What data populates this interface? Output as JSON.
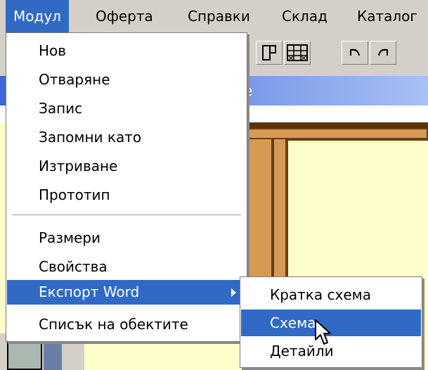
{
  "menubar": {
    "items": [
      "Модул",
      "Оферта",
      "Справки",
      "Склад",
      "Каталог"
    ],
    "active_index": 0
  },
  "window": {
    "title_fragment": "е"
  },
  "dropdown": {
    "items": [
      "Нов",
      "Отваряне",
      "Запис",
      "Запомни като",
      "Изтриване",
      "Прототип",
      "Размери",
      "Свойства",
      "Експорт Word",
      "Списък на обектите"
    ],
    "highlighted": "Експорт Word",
    "has_submenu": "Експорт Word"
  },
  "submenu": {
    "items": [
      "Кратка схема",
      "Схема",
      "Детайли"
    ],
    "highlighted": "Схема"
  },
  "colors": {
    "highlight": "#316ac5",
    "wood": "#d79a55",
    "canvas": "#ffffcc",
    "chrome": "#d4d0c8"
  },
  "icons": [
    "window-icon",
    "grid-icon",
    "undo-icon",
    "redo-icon",
    "submenu-arrow-icon",
    "mouse-cursor-icon"
  ]
}
